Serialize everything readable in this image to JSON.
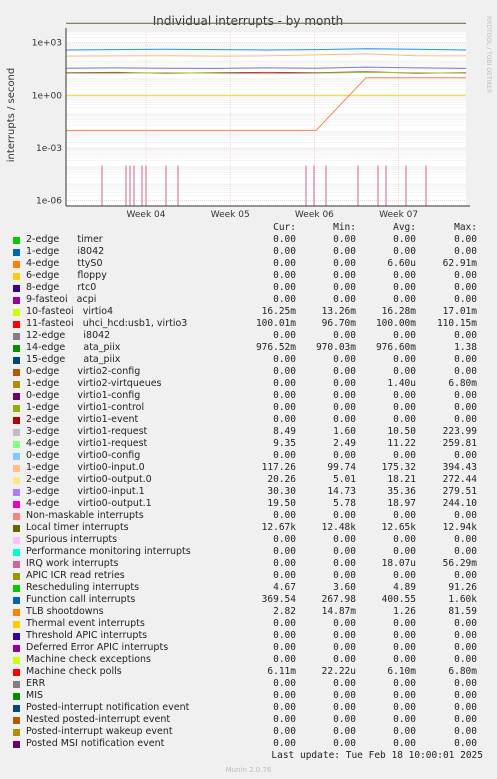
{
  "chart_data": {
    "type": "line",
    "title": "Individual interrupts - by month",
    "ylabel": "interrupts / second",
    "yscale": "log",
    "ylim": [
      5e-07,
      4000
    ],
    "y_ticks": [
      {
        "value": 1000,
        "label": "1e+03"
      },
      {
        "value": 1,
        "label": "1e+00"
      },
      {
        "value": 0.001,
        "label": "1e-03"
      },
      {
        "value": 1e-06,
        "label": "1e-06"
      }
    ],
    "x_ticks": [
      "Week 04",
      "Week 05",
      "Week 06",
      "Week 07"
    ],
    "grid": true,
    "side_label": "RRDTOOL / TOBI OETIKER",
    "series": [
      {
        "name": "Local timer interrupts",
        "color": "#556B2F",
        "values": [
          12600,
          12600,
          12600,
          12600,
          12600,
          12600,
          12600,
          12600,
          12600
        ]
      },
      {
        "name": "virtio0-input.0",
        "color": "#FFBB80",
        "values": [
          170,
          175,
          180,
          170,
          175,
          200,
          230,
          180,
          175
        ]
      },
      {
        "name": "Function call interrupts",
        "color": "#1E90FF",
        "values": [
          380,
          400,
          420,
          400,
          380,
          400,
          450,
          420,
          380
        ]
      },
      {
        "name": "virtio0-input.1",
        "color": "#7A7AC8",
        "values": [
          35,
          36,
          35,
          34,
          36,
          35,
          40,
          36,
          34
        ]
      },
      {
        "name": "virtio0-output.1",
        "color": "#C8228C",
        "values": [
          19,
          20,
          18,
          19,
          20,
          19,
          22,
          18,
          19
        ]
      },
      {
        "name": "virtio0-output.0",
        "color": "#9ACD32",
        "values": [
          18,
          18,
          19,
          18,
          17,
          18,
          20,
          19,
          18
        ]
      },
      {
        "name": "ata_piix",
        "color": "#FFD700",
        "values": [
          1,
          1,
          1,
          1,
          1,
          1,
          1,
          1,
          1
        ]
      },
      {
        "name": "virtio1-request",
        "color": "#FF7F50",
        "values": [
          0.01,
          0.01,
          0.01,
          0.01,
          0.01,
          0.01,
          10,
          10,
          10
        ]
      }
    ]
  },
  "legend": {
    "headers": [
      "Cur:",
      "Min:",
      "Avg:",
      "Max:"
    ],
    "rows": [
      {
        "color": "#00CC00",
        "label": "2-edge      timer",
        "cur": "0.00",
        "min": "0.00",
        "avg": "0.00",
        "max": "0.00"
      },
      {
        "color": "#0066B3",
        "label": "1-edge      i8042",
        "cur": "0.00",
        "min": "0.00",
        "avg": "0.00",
        "max": "0.00"
      },
      {
        "color": "#FF8000",
        "label": "4-edge      ttyS0",
        "cur": "0.00",
        "min": "0.00",
        "avg": "6.60u",
        "max": "62.91m"
      },
      {
        "color": "#FFCC00",
        "label": "6-edge      floppy",
        "cur": "0.00",
        "min": "0.00",
        "avg": "0.00",
        "max": "0.00"
      },
      {
        "color": "#330099",
        "label": "8-edge      rtc0",
        "cur": "0.00",
        "min": "0.00",
        "avg": "0.00",
        "max": "0.00"
      },
      {
        "color": "#990099",
        "label": "9-fasteoi   acpi",
        "cur": "0.00",
        "min": "0.00",
        "avg": "0.00",
        "max": "0.00"
      },
      {
        "color": "#CCFF00",
        "label": "10-fasteoi   virtio4",
        "cur": "16.25m",
        "min": "13.26m",
        "avg": "16.28m",
        "max": "17.01m"
      },
      {
        "color": "#FF0000",
        "label": "11-fasteoi   uhci_hcd:usb1, virtio3",
        "cur": "100.01m",
        "min": "96.70m",
        "avg": "100.00m",
        "max": "110.15m"
      },
      {
        "color": "#808080",
        "label": "12-edge      i8042",
        "cur": "0.00",
        "min": "0.00",
        "avg": "0.00",
        "max": "0.00"
      },
      {
        "color": "#008F00",
        "label": "14-edge      ata_piix",
        "cur": "976.52m",
        "min": "970.03m",
        "avg": "976.60m",
        "max": "1.38"
      },
      {
        "color": "#00487D",
        "label": "15-edge      ata_piix",
        "cur": "0.00",
        "min": "0.00",
        "avg": "0.00",
        "max": "0.00"
      },
      {
        "color": "#B35A00",
        "label": "0-edge      virtio2-config",
        "cur": "0.00",
        "min": "0.00",
        "avg": "0.00",
        "max": "0.00"
      },
      {
        "color": "#B38F00",
        "label": "1-edge      virtio2-virtqueues",
        "cur": "0.00",
        "min": "0.00",
        "avg": "1.40u",
        "max": "6.80m"
      },
      {
        "color": "#6B006B",
        "label": "0-edge      virtio1-config",
        "cur": "0.00",
        "min": "0.00",
        "avg": "0.00",
        "max": "0.00"
      },
      {
        "color": "#8FB300",
        "label": "1-edge      virtio1-control",
        "cur": "0.00",
        "min": "0.00",
        "avg": "0.00",
        "max": "0.00"
      },
      {
        "color": "#B30000",
        "label": "2-edge      virtio1-event",
        "cur": "0.00",
        "min": "0.00",
        "avg": "0.00",
        "max": "0.00"
      },
      {
        "color": "#BEBEBE",
        "label": "3-edge      virtio1-request",
        "cur": "8.49",
        "min": "1.60",
        "avg": "10.50",
        "max": "223.99"
      },
      {
        "color": "#80FF80",
        "label": "4-edge      virtio1-request",
        "cur": "9.35",
        "min": "2.49",
        "avg": "11.22",
        "max": "259.81"
      },
      {
        "color": "#80C9FF",
        "label": "0-edge      virtio0-config",
        "cur": "0.00",
        "min": "0.00",
        "avg": "0.00",
        "max": "0.00"
      },
      {
        "color": "#FFC080",
        "label": "1-edge      virtio0-input.0",
        "cur": "117.26",
        "min": "99.74",
        "avg": "175.32",
        "max": "394.43"
      },
      {
        "color": "#FFE680",
        "label": "2-edge      virtio0-output.0",
        "cur": "20.26",
        "min": "5.01",
        "avg": "18.21",
        "max": "272.44"
      },
      {
        "color": "#AA80FF",
        "label": "3-edge      virtio0-input.1",
        "cur": "30.30",
        "min": "14.73",
        "avg": "35.36",
        "max": "279.51"
      },
      {
        "color": "#EE00CC",
        "label": "4-edge      virtio0-output.1",
        "cur": "19.50",
        "min": "5.78",
        "avg": "18.97",
        "max": "244.10"
      },
      {
        "color": "#FF8080",
        "label": "Non-maskable interrupts",
        "cur": "0.00",
        "min": "0.00",
        "avg": "0.00",
        "max": "0.00"
      },
      {
        "color": "#666600",
        "label": "Local timer interrupts",
        "cur": "12.67k",
        "min": "12.48k",
        "avg": "12.65k",
        "max": "12.94k"
      },
      {
        "color": "#FFBFFF",
        "label": "Spurious interrupts",
        "cur": "0.00",
        "min": "0.00",
        "avg": "0.00",
        "max": "0.00"
      },
      {
        "color": "#00FFCC",
        "label": "Performance monitoring interrupts",
        "cur": "0.00",
        "min": "0.00",
        "avg": "0.00",
        "max": "0.00"
      },
      {
        "color": "#CC6699",
        "label": "IRQ work interrupts",
        "cur": "0.00",
        "min": "0.00",
        "avg": "18.07u",
        "max": "56.29m"
      },
      {
        "color": "#999900",
        "label": "APIC ICR read retries",
        "cur": "0.00",
        "min": "0.00",
        "avg": "0.00",
        "max": "0.00"
      },
      {
        "color": "#00CC00",
        "label": "Rescheduling interrupts",
        "cur": "4.67",
        "min": "3.60",
        "avg": "4.89",
        "max": "91.26"
      },
      {
        "color": "#0066B3",
        "label": "Function call interrupts",
        "cur": "369.54",
        "min": "267.98",
        "avg": "400.55",
        "max": "1.60k"
      },
      {
        "color": "#FF8000",
        "label": "TLB shootdowns",
        "cur": "2.82",
        "min": "14.87m",
        "avg": "1.26",
        "max": "81.59"
      },
      {
        "color": "#FFCC00",
        "label": "Thermal event interrupts",
        "cur": "0.00",
        "min": "0.00",
        "avg": "0.00",
        "max": "0.00"
      },
      {
        "color": "#330099",
        "label": "Threshold APIC interrupts",
        "cur": "0.00",
        "min": "0.00",
        "avg": "0.00",
        "max": "0.00"
      },
      {
        "color": "#990099",
        "label": "Deferred Error APIC interrupts",
        "cur": "0.00",
        "min": "0.00",
        "avg": "0.00",
        "max": "0.00"
      },
      {
        "color": "#CCFF00",
        "label": "Machine check exceptions",
        "cur": "0.00",
        "min": "0.00",
        "avg": "0.00",
        "max": "0.00"
      },
      {
        "color": "#FF0000",
        "label": "Machine check polls",
        "cur": "6.11m",
        "min": "22.22u",
        "avg": "6.10m",
        "max": "6.80m"
      },
      {
        "color": "#808080",
        "label": "ERR",
        "cur": "0.00",
        "min": "0.00",
        "avg": "0.00",
        "max": "0.00"
      },
      {
        "color": "#008F00",
        "label": "MIS",
        "cur": "0.00",
        "min": "0.00",
        "avg": "0.00",
        "max": "0.00"
      },
      {
        "color": "#00487D",
        "label": "Posted-interrupt notification event",
        "cur": "0.00",
        "min": "0.00",
        "avg": "0.00",
        "max": "0.00"
      },
      {
        "color": "#B35A00",
        "label": "Nested posted-interrupt event",
        "cur": "0.00",
        "min": "0.00",
        "avg": "0.00",
        "max": "0.00"
      },
      {
        "color": "#B38F00",
        "label": "Posted-interrupt wakeup event",
        "cur": "0.00",
        "min": "0.00",
        "avg": "0.00",
        "max": "0.00"
      },
      {
        "color": "#6B006B",
        "label": "Posted MSI notification event",
        "cur": "0.00",
        "min": "0.00",
        "avg": "0.00",
        "max": "0.00"
      }
    ]
  },
  "footer": {
    "last_update": "Last update: Tue Feb 18 10:00:01 2025",
    "version": "Munin 2.0.76"
  }
}
